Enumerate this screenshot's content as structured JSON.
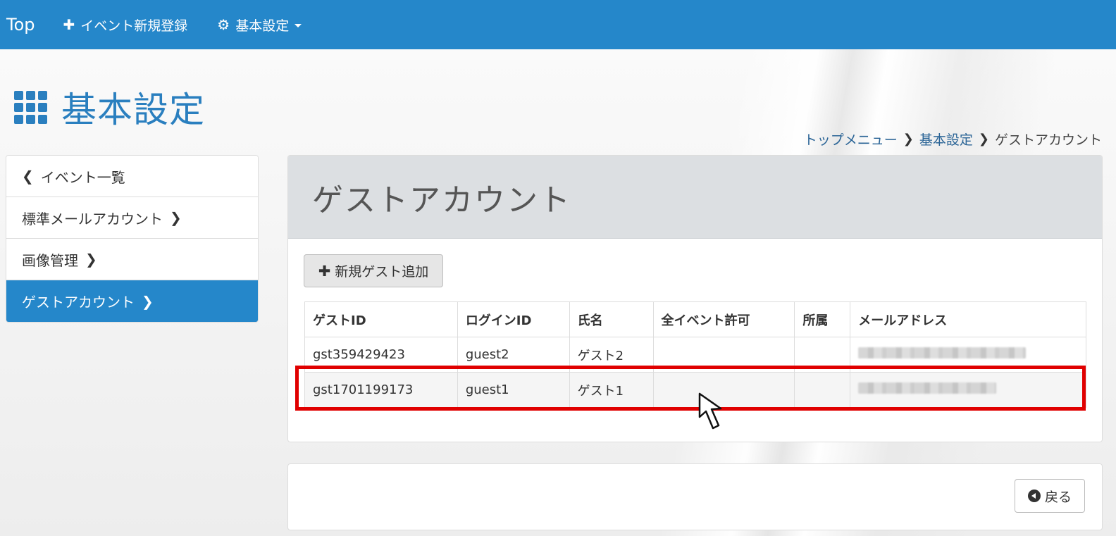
{
  "navbar": {
    "brand": "Top",
    "items": [
      {
        "icon": "plus-icon",
        "label": "イベント新規登録"
      },
      {
        "icon": "gear-icon",
        "label": "基本設定"
      }
    ]
  },
  "page": {
    "title": "基本設定"
  },
  "breadcrumb": {
    "items": [
      "トップメニュー",
      "基本設定"
    ],
    "current": "ゲストアカウント"
  },
  "sidebar": {
    "items": [
      {
        "label": "イベント一覧"
      },
      {
        "label": "標準メールアカウント"
      },
      {
        "label": "画像管理"
      },
      {
        "label": "ゲストアカウント",
        "active": true
      }
    ]
  },
  "panel": {
    "title": "ゲストアカウント",
    "add_button": "新規ゲスト追加",
    "table": {
      "headers": [
        "ゲストID",
        "ログインID",
        "氏名",
        "全イベント許可",
        "所属",
        "メールアドレス"
      ],
      "rows": [
        {
          "guest_id": "gst359429423",
          "login_id": "guest2",
          "name": "ゲスト2",
          "all_events": "",
          "affiliation": "",
          "email_redacted": true
        },
        {
          "guest_id": "gst1701199173",
          "login_id": "guest1",
          "name": "ゲスト1",
          "all_events": "",
          "affiliation": "",
          "email_redacted": true
        }
      ]
    }
  },
  "footer": {
    "back_button": "戻る"
  },
  "colors": {
    "accent": "#2587ca",
    "highlight": "#e00000"
  }
}
